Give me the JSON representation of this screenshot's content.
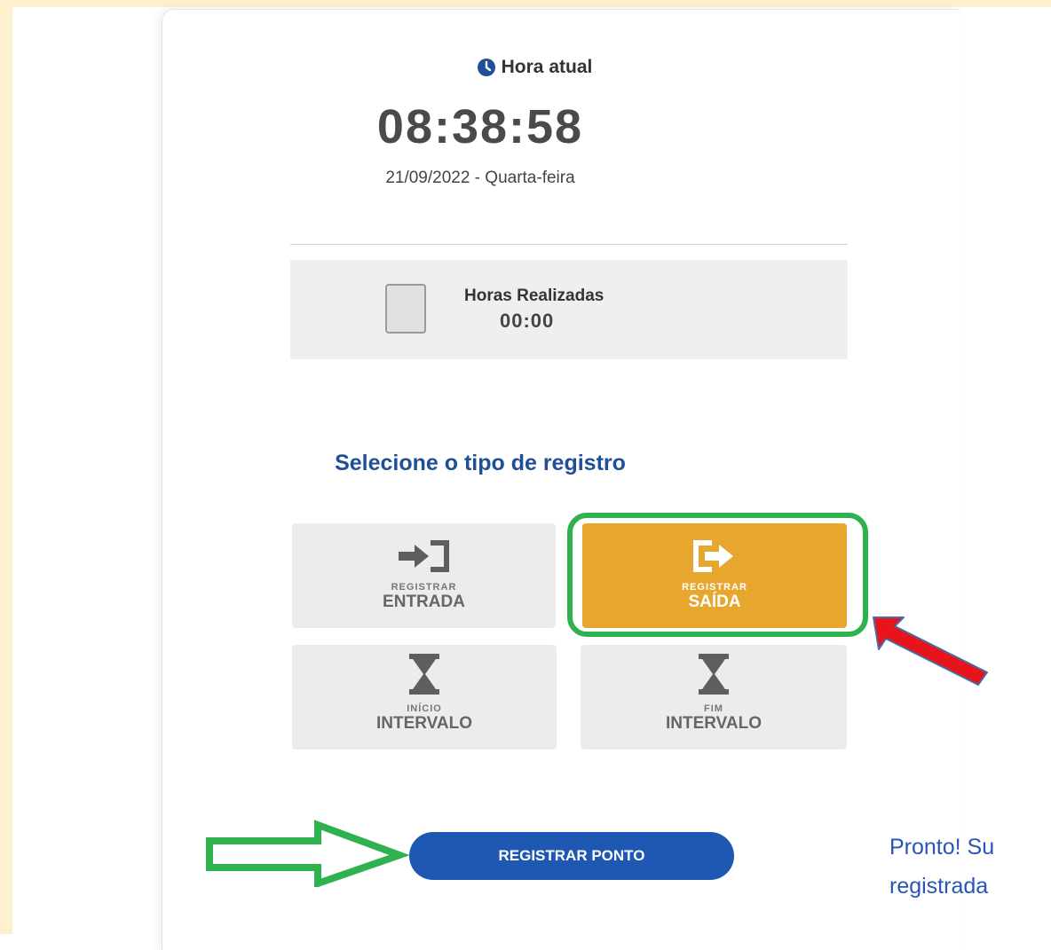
{
  "clock": {
    "label": "Hora atual",
    "time": "08:38:58",
    "date": "21/09/2022 - Quarta-feira"
  },
  "hours": {
    "label": "Horas Realizadas",
    "value": "00:00"
  },
  "select_title": "Selecione o tipo de registro",
  "options": [
    {
      "small": "REGISTRAR",
      "big": "ENTRADA",
      "icon": "sign-in-icon",
      "selected": false
    },
    {
      "small": "REGISTRAR",
      "big": "SAÍDA",
      "icon": "sign-out-icon",
      "selected": true
    },
    {
      "small": "INÍCIO",
      "big": "INTERVALO",
      "icon": "hourglass-icon",
      "selected": false
    },
    {
      "small": "FIM",
      "big": "INTERVALO",
      "icon": "hourglass-icon",
      "selected": false
    }
  ],
  "register_button": "REGISTRAR PONTO",
  "annotation": {
    "line1": "Pronto! Su",
    "line2": "registrada"
  },
  "colors": {
    "accent_blue": "#1e58b3",
    "selected_tile": "#e7a62e",
    "highlight_green": "#2fb14f",
    "arrow_red": "#e8141b"
  }
}
